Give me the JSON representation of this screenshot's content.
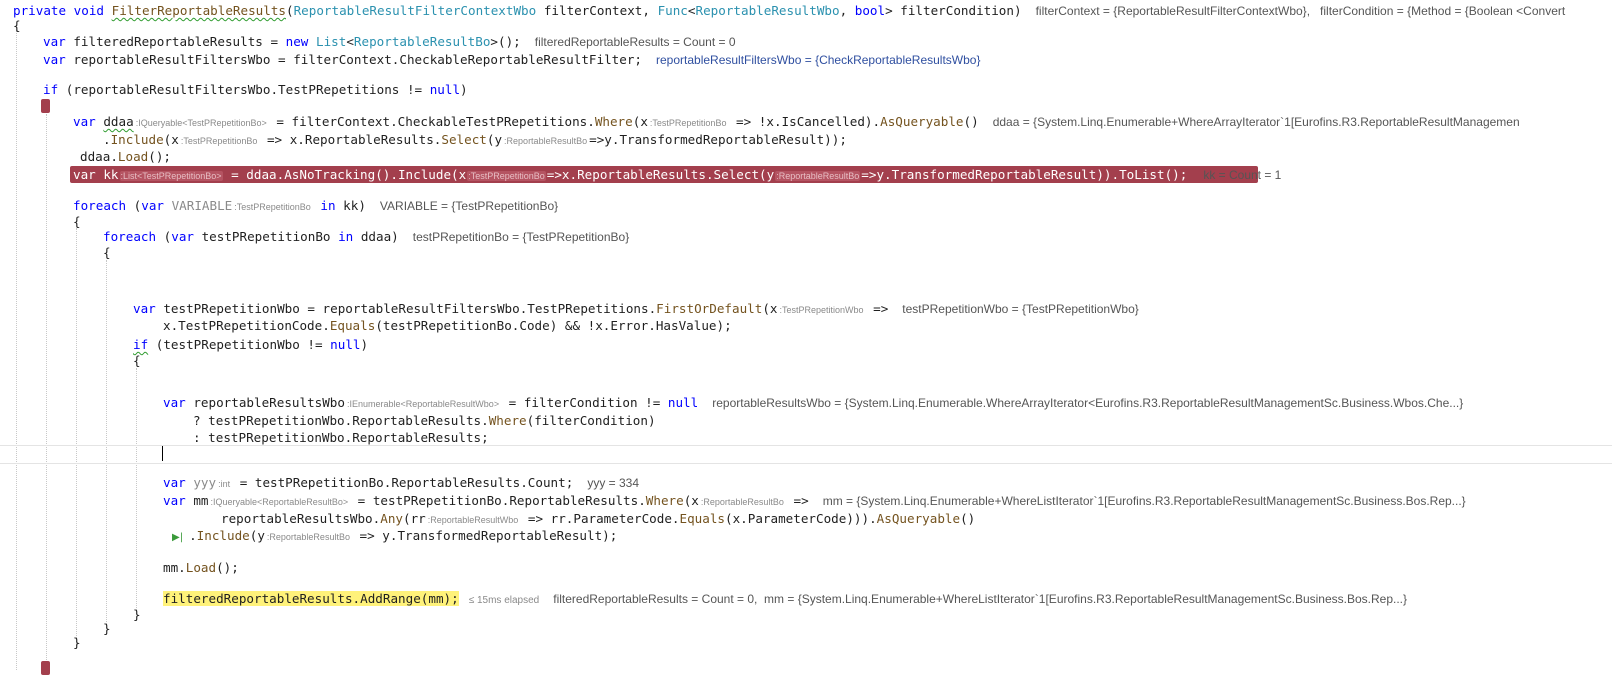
{
  "code": {
    "l1": {
      "kw_private": "private",
      "kw_void": "void",
      "method": "FilterReportableResults",
      "p_open": "(",
      "type1": "ReportableResultFilterContextWbo",
      "arg1": " filterContext, ",
      "type2": "Func",
      "lt": "<",
      "type3": "ReportableResultWbo",
      "comma": ", ",
      "kw_bool": "bool",
      "gt_arg2": "> filterCondition)",
      "dbg1": "filterContext = {ReportableResultFilterContextWbo},",
      "dbg2": "filterCondition = {Method = {Boolean <Convert"
    },
    "l2": {
      "brace": "{"
    },
    "l3": {
      "kw_var": "var",
      "name": " filteredReportableResults = ",
      "kw_new": "new",
      "sp": " ",
      "type_list": "List",
      "lt": "<",
      "type_bo": "ReportableResultBo",
      "end": ">();",
      "dbg": "filteredReportableResults = Count = 0"
    },
    "l4": {
      "kw_var": "var",
      "text": " reportableResultFiltersWbo = filterContext.CheckableReportableResultFilter;",
      "dbg": "reportableResultFiltersWbo = {CheckReportableResultsWbo}"
    },
    "l5": {
      "kw_if": "if",
      "text": " (reportableResultFiltersWbo.TestPRepetitions != ",
      "kw_null": "null",
      "end": ")"
    },
    "l7": {
      "kw_var": "var",
      "name": "ddaa",
      "hint1": ":IQueryable<TestPRepetitionBo>",
      "t1": " = filterContext.CheckableTestPRepetitions.",
      "m_where": "Where",
      "t2": "(x",
      "hint2": ":TestPRepetitionBo",
      "t3": " => !x.IsCancelled).",
      "m_asq": "AsQueryable",
      "t4": "()",
      "dbg": "ddaa = {System.Linq.Enumerable+WhereArrayIterator`1[Eurofins.R3.ReportableResultManagemen"
    },
    "l8": {
      "t0": ".",
      "m_include": "Include",
      "t1": "(x",
      "hint1": ":TestPRepetitionBo",
      "t2": " => x.ReportableResults.",
      "m_select": "Select",
      "t3": "(y",
      "hint2": ":ReportableResultBo",
      "t4": "=>y.TransformedReportableResult));"
    },
    "l9": {
      "t0": "ddaa.",
      "m_load": "Load",
      "t1": "();"
    },
    "l10": {
      "t0": "var kk",
      "hint1": ":List<TestPRepetitionBo>",
      "t1": " = ddaa.AsNoTracking().Include(x",
      "hint2": ":TestPRepetitionBo",
      "t2": "=>x.ReportableResults.Select(y",
      "hint3": ":ReportableResultBo",
      "t3": "=>y.TransformedReportableResult)).ToList();",
      "dbg": "kk = Count = 1"
    },
    "l11": {
      "kw_foreach": "foreach",
      "t0": " (",
      "kw_var": "var",
      "sp": " ",
      "name": "VARIABLE",
      "hint": ":TestPRepetitionBo",
      "kw_in": "in",
      "t1": " kk)",
      "dbg": "VARIABLE = {TestPRepetitionBo}"
    },
    "l12": {
      "brace": "{"
    },
    "l13": {
      "kw_foreach": "foreach",
      "t0": " (",
      "kw_var": "var",
      "t1": " testPRepetitionBo ",
      "kw_in": "in",
      "t2": " ddaa)",
      "dbg": "testPRepetitionBo = {TestPRepetitionBo}"
    },
    "l14": {
      "brace": "{"
    },
    "l15": {
      "kw_var": "var",
      "t0": " testPRepetitionWbo = reportableResultFiltersWbo.TestPRepetitions.",
      "m_first": "FirstOrDefault",
      "t1": "(x",
      "hint": ":TestPRepetitionWbo",
      "t2": " =>",
      "dbg": "testPRepetitionWbo = {TestPRepetitionWbo}"
    },
    "l16": {
      "t0": "x.TestPRepetitionCode.",
      "m_equals": "Equals",
      "t1": "(testPRepetitionBo.Code) && !x.Error.HasValue);"
    },
    "l17": {
      "kw_if": "if",
      "t0": " (testPRepetitionWbo != ",
      "kw_null": "null",
      "t1": ")"
    },
    "l18": {
      "brace": "{"
    },
    "l19": {
      "kw_var": "var",
      "t0": " reportableResultsWbo",
      "hint": ":IEnumerable<ReportableResultWbo>",
      "t1": " = filterCondition != ",
      "kw_null": "null",
      "dbg": "reportableResultsWbo = {System.Linq.Enumerable.WhereArrayIterator<Eurofins.R3.ReportableResultManagementSc.Business.Wbos.Che...}"
    },
    "l20": {
      "t0": "? testPRepetitionWbo.ReportableResults.",
      "m_where": "Where",
      "t1": "(filterCondition)"
    },
    "l21": {
      "t0": ": testPRepetitionWbo.ReportableResults;"
    },
    "l23": {
      "kw_var": "var",
      "sp": " ",
      "name": "yyy",
      "hint": ":int",
      "t0": " = testPRepetitionBo.ReportableResults.Count;",
      "dbg": "yyy = 334"
    },
    "l24": {
      "kw_var": "var",
      "t0": " mm",
      "hint1": ":IQueryable<ReportableResultBo>",
      "t1": " = testPRepetitionBo.ReportableResults.",
      "m_where": "Where",
      "t2": "(x",
      "hint2": ":ReportableResultBo",
      "t3": " =>",
      "dbg": "mm = {System.Linq.Enumerable+WhereListIterator`1[Eurofins.R3.ReportableResultManagementSc.Business.Bos.Rep...}"
    },
    "l25": {
      "t0": "reportableResultsWbo.",
      "m_any": "Any",
      "t1": "(rr",
      "hint": ":ReportableResultWbo",
      "t2": " => rr.ParameterCode.",
      "m_equals": "Equals",
      "t3": "(x.ParameterCode))).",
      "m_asq": "AsQueryable",
      "t4": "()"
    },
    "l26": {
      "arrow": "▶|",
      "t0": ".",
      "m_include": "Include",
      "t1": "(y",
      "hint": ":ReportableResultBo",
      "t2": " => y.TransformedReportableResult);"
    },
    "l27": {
      "t0": "mm.",
      "m_load": "Load",
      "t1": "();"
    },
    "l28": {
      "t0": "filteredReportableResults.AddRange(mm);",
      "elapsed": "≤ 15ms elapsed",
      "dbg": "filteredReportableResults = Count = 0,  mm = {System.Linq.Enumerable+WhereListIterator`1[Eurofins.R3.ReportableResultManagementSc.Business.Bos.Rep...}"
    },
    "l29": {
      "brace": "}"
    },
    "l30": {
      "brace": "}"
    },
    "l31": {
      "brace": "}"
    }
  }
}
